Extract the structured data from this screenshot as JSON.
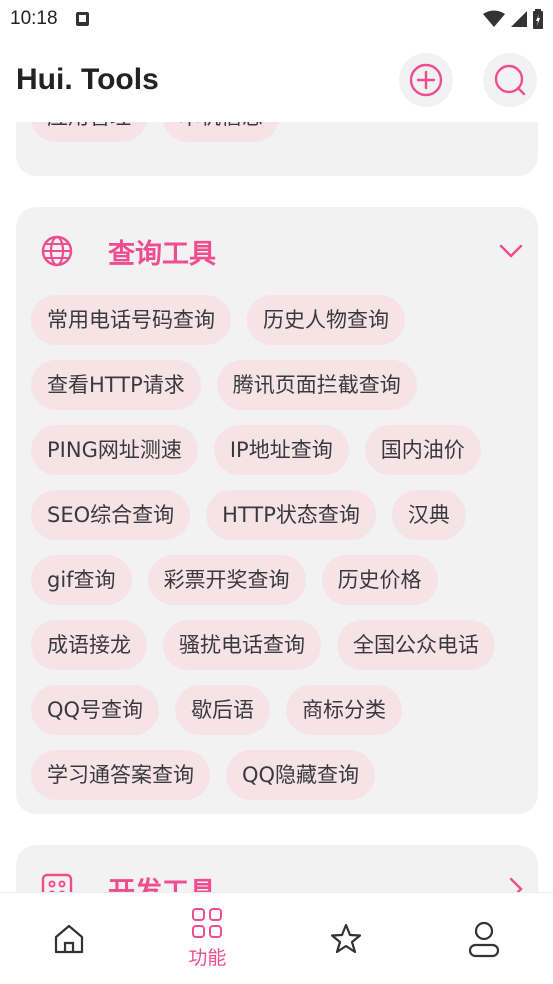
{
  "status_bar": {
    "time": "10:18"
  },
  "header": {
    "title": "Hui. Tools"
  },
  "top_card": {
    "chips": [
      "应用管理",
      "本机信息"
    ]
  },
  "query_card": {
    "title": "查询工具",
    "chips": [
      "常用电话号码查询",
      "历史人物查询",
      "查看HTTP请求",
      "腾讯页面拦截查询",
      "PING网址测速",
      "IP地址查询",
      "国内油价",
      "SEO综合查询",
      "HTTP状态查询",
      "汉典",
      "gif查询",
      "彩票开奖查询",
      "历史价格",
      "成语接龙",
      "骚扰电话查询",
      "全国公众电话",
      "QQ号查询",
      "歇后语",
      "商标分类",
      "学习通答案查询",
      "QQ隐藏查询"
    ]
  },
  "dev_card": {
    "title": "开发工具"
  },
  "bottom_nav": {
    "active_label": "功能"
  },
  "colors": {
    "accent": "#ee4e8f",
    "chip_bg": "#f5e3e8",
    "card_bg": "#f3f2f3"
  }
}
